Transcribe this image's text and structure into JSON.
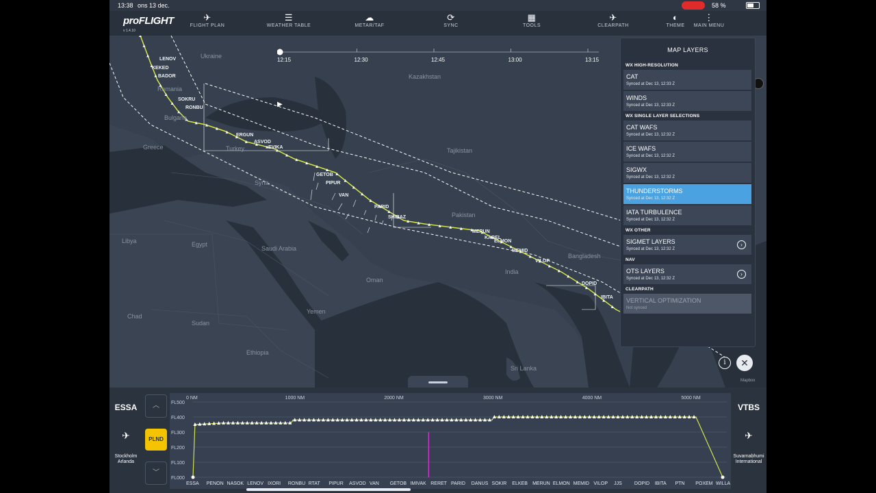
{
  "status_bar": {
    "time": "13:38",
    "date": "ons 13 dec.",
    "battery": "58 %",
    "battery_level": 0.58
  },
  "app": {
    "brand": "proFLIGHT",
    "version": "v 1.4.10"
  },
  "nav": [
    {
      "id": "flight-plan",
      "label": "FLIGHT PLAN",
      "icon": "airplane-icon",
      "glyph": "✈"
    },
    {
      "id": "weather-table",
      "label": "WEATHER TABLE",
      "icon": "list-icon",
      "glyph": "☰"
    },
    {
      "id": "metar-taf",
      "label": "METAR/TAF",
      "icon": "weather-cloud-icon",
      "glyph": "☁"
    },
    {
      "id": "sync",
      "label": "SYNC",
      "icon": "sync-cloud-icon",
      "glyph": "⟳"
    },
    {
      "id": "tools",
      "label": "TOOLS",
      "icon": "calculator-icon",
      "glyph": "▦"
    },
    {
      "id": "clearpath",
      "label": "CLEARPATH",
      "icon": "clearpath-plane-icon",
      "glyph": "✈"
    },
    {
      "id": "theme",
      "label": "THEME",
      "icon": "theme-contrast-icon",
      "glyph": "◐"
    },
    {
      "id": "main-menu",
      "label": "MAIN MENU",
      "icon": "more-vertical-icon",
      "glyph": "⋮"
    }
  ],
  "map": {
    "countries": [
      "Ukraine",
      "Romania",
      "Bulgaria",
      "Greece",
      "Turkey",
      "Syria",
      "Libya",
      "Egypt",
      "Saudi Arabia",
      "Oman",
      "Yemen",
      "Chad",
      "Sudan",
      "Ethiopia",
      "Kazakhstan",
      "Tajikistan",
      "Pakistan",
      "India",
      "Bangladesh",
      "Sri Lanka"
    ],
    "waypoints": [
      "LENOV",
      "KEKED",
      "BADOR",
      "SOKRU",
      "RONBU",
      "ERGUN",
      "ASVOD",
      "EVIKA",
      "GETOB",
      "PIPUR",
      "VAN",
      "PARID",
      "SHIRAZ",
      "MERUN",
      "KABEL",
      "ELMON",
      "MEMID",
      "VILOP",
      "DOPID",
      "IBITA"
    ],
    "attribution": "Mapbox"
  },
  "timeline": {
    "ticks": [
      "12:15",
      "12:30",
      "12:45",
      "13:00",
      "13:15"
    ],
    "position": 0.0
  },
  "layers_panel": {
    "title": "MAP LAYERS",
    "sections": [
      {
        "title": "WX HIGH-RESOLUTION",
        "items": [
          {
            "name": "CAT",
            "status": "Synced at Dec 13, 12:33 Z"
          },
          {
            "name": "WINDS",
            "status": "Synced at Dec 13, 12:33 Z"
          }
        ]
      },
      {
        "title": "WX SINGLE LAYER SELECTIONS",
        "items": [
          {
            "name": "CAT WAFS",
            "status": "Synced at Dec 13, 12:32 Z"
          },
          {
            "name": "ICE WAFS",
            "status": "Synced at Dec 13, 12:32 Z"
          },
          {
            "name": "SIGWX",
            "status": "Synced at Dec 13, 12:32 Z"
          },
          {
            "name": "THUNDERSTORMS",
            "status": "Synced at Dec 13, 12:32 Z",
            "active": true
          },
          {
            "name": "IATA TURBULENCE",
            "status": "Synced at Dec 13, 12:32 Z"
          }
        ]
      },
      {
        "title": "WX OTHER",
        "items": [
          {
            "name": "SIGMET LAYERS",
            "status": "Synced at Dec 13, 12:32 Z",
            "chevron": true
          }
        ]
      },
      {
        "title": "NAV",
        "items": [
          {
            "name": "OTS LAYERS",
            "status": "Synced at Dec 13, 12:32 Z",
            "chevron": true
          }
        ]
      },
      {
        "title": "CLEARPATH",
        "items": [
          {
            "name": "VERTICAL OPTIMIZATION",
            "status": "Not synced",
            "disabled": true
          }
        ]
      }
    ]
  },
  "departure": {
    "code": "ESSA",
    "name": "Stockholm Arlanda"
  },
  "arrival": {
    "code": "VTBS",
    "name": "Suvarnabhumi International"
  },
  "profile": {
    "plnd_label": "PLND",
    "levels": [
      "FL500",
      "FL400",
      "FL300",
      "FL200",
      "FL100",
      "FL000"
    ],
    "distances": [
      "0 NM",
      "1000 NM",
      "2000 NM",
      "3000 NM",
      "4000 NM",
      "5000 NM"
    ],
    "route_labels": [
      "ESSA",
      "PENON",
      "NASOK",
      "LENOV",
      "IXORI",
      "RONBU",
      "RTAT",
      "PIPUR",
      "ASVOD",
      "VAN",
      "GETOB",
      "IMIVAK",
      "RERET",
      "PARID",
      "DANUS",
      "SOKIR",
      "ELKEB",
      "MERUN",
      "ELMON",
      "MEMID",
      "VILOP",
      "JJS",
      "DOPID",
      "IBITA",
      "PTN",
      "POXEM",
      "WILLA"
    ],
    "total_nm": 5350,
    "current_nm": 2380,
    "flight_levels": [
      {
        "nm": 0,
        "fl": 0
      },
      {
        "nm": 20,
        "fl": 350
      },
      {
        "nm": 300,
        "fl": 360
      },
      {
        "nm": 990,
        "fl": 360
      },
      {
        "nm": 1010,
        "fl": 380
      },
      {
        "nm": 3020,
        "fl": 380
      },
      {
        "nm": 3040,
        "fl": 400
      },
      {
        "nm": 5080,
        "fl": 400
      },
      {
        "nm": 5350,
        "fl": 0
      }
    ]
  }
}
